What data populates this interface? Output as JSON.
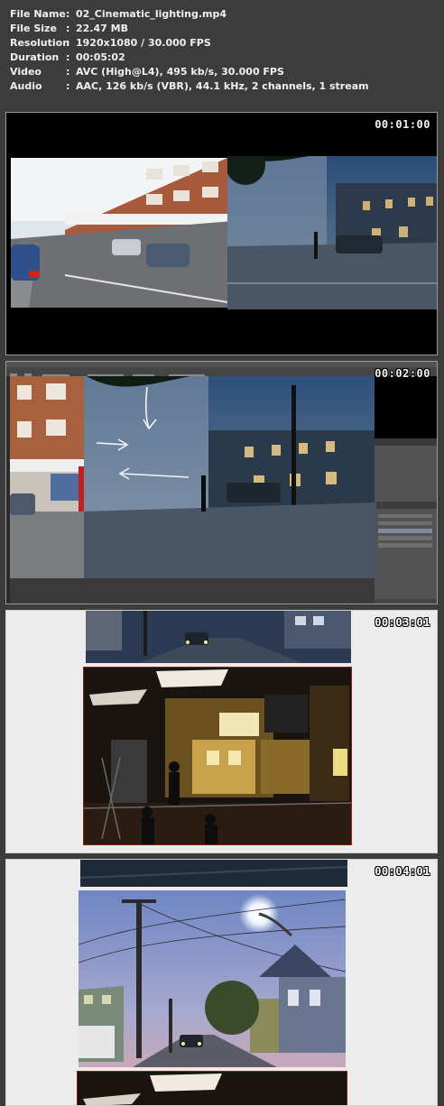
{
  "info": [
    {
      "label": "File Name",
      "value": "02_Cinematic_lighting.mp4"
    },
    {
      "label": "File Size",
      "value": "22.47 MB"
    },
    {
      "label": "Resolution",
      "value": "1920x1080 / 30.000 FPS"
    },
    {
      "label": "Duration",
      "value": "00:05:02"
    },
    {
      "label": "Video",
      "value": "AVC (High@L4), 495 kb/s, 30.000 FPS"
    },
    {
      "label": "Audio",
      "value": "AAC, 126 kb/s (VBR), 44.1 kHz, 2 channels, 1 stream"
    }
  ],
  "separator": ":",
  "thumbnails": [
    {
      "timestamp": "00:01:00"
    },
    {
      "timestamp": "00:02:00"
    },
    {
      "timestamp": "00:03:01"
    },
    {
      "timestamp": "00:04:01"
    }
  ]
}
